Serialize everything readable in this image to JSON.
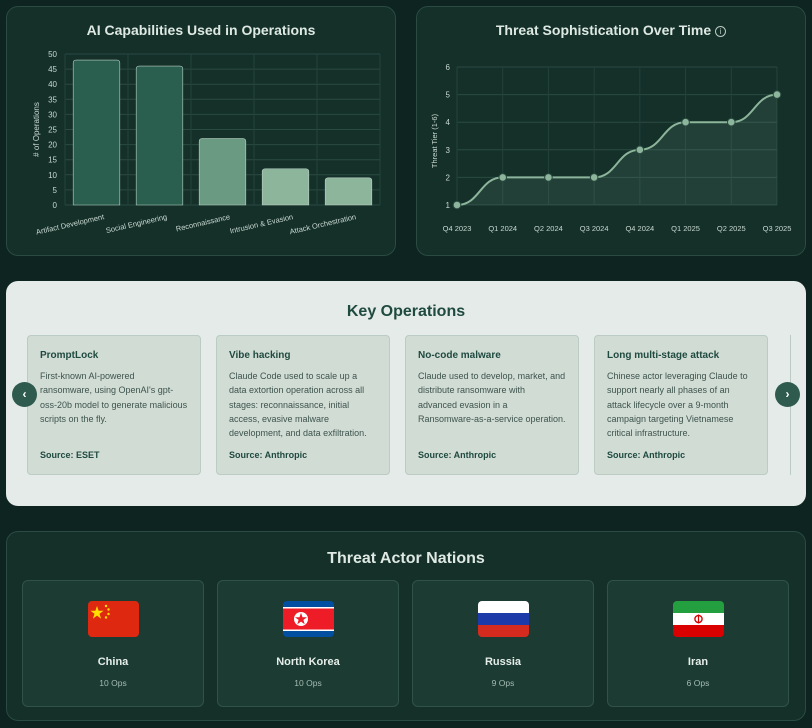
{
  "capabilities_panel": {
    "title": "AI Capabilities Used in Operations"
  },
  "threat_panel": {
    "title": "Threat Sophistication Over Time",
    "info_icon": "info-icon"
  },
  "chart_data": [
    {
      "type": "bar",
      "title": "AI Capabilities Used in Operations",
      "ylabel": "# of Operations",
      "xlabel": "",
      "categories": [
        "Artifact Development",
        "Social Engineering",
        "Reconnaissance",
        "Intrusion & Evasion",
        "Attack Orchestration"
      ],
      "values": [
        48,
        46,
        22,
        12,
        9
      ],
      "ylim": [
        0,
        50
      ],
      "yticks": [
        0,
        5,
        10,
        15,
        20,
        25,
        30,
        35,
        40,
        45,
        50
      ],
      "colors": [
        "#2a5e4f",
        "#2a5e4f",
        "#6a9a82",
        "#8cb59b",
        "#8cb59b"
      ],
      "grid": true
    },
    {
      "type": "line",
      "title": "Threat Sophistication Over Time",
      "ylabel": "Threat Tier (1-6)",
      "xlabel": "",
      "x": [
        "Q4 2023",
        "Q1 2024",
        "Q2 2024",
        "Q3 2024",
        "Q4 2024",
        "Q1 2025",
        "Q2 2025",
        "Q3 2025"
      ],
      "values": [
        1,
        2,
        2,
        2,
        3,
        4,
        4,
        5
      ],
      "ylim": [
        1,
        6
      ],
      "yticks": [
        1,
        2,
        3,
        4,
        5,
        6
      ],
      "line_color": "#8cb59b",
      "grid": true
    }
  ],
  "operations": {
    "title": "Key Operations",
    "prev_icon": "chevron-left-icon",
    "next_icon": "chevron-right-icon",
    "cards": [
      {
        "title": "PromptLock",
        "description": "First-known AI-powered ransomware, using OpenAI's gpt-oss-20b model to generate malicious scripts on the fly.",
        "source": "Source: ESET"
      },
      {
        "title": "Vibe hacking",
        "description": "Claude Code used to scale up a data extortion operation across all stages: reconnaissance, initial access, evasive malware development, and data exfiltration.",
        "source": "Source: Anthropic"
      },
      {
        "title": "No-code malware",
        "description": "Claude used to develop, market, and distribute ransomware with advanced evasion in a Ransomware-as-a-service operation.",
        "source": "Source: Anthropic"
      },
      {
        "title": "Long multi-stage attack",
        "description": "Chinese actor leveraging Claude to support nearly all phases of an attack lifecycle over a 9-month campaign targeting Vietnamese critical infrastructure.",
        "source": "Source: Anthropic"
      }
    ]
  },
  "nations": {
    "title": "Threat Actor Nations",
    "items": [
      {
        "name": "China",
        "ops": "10 Ops",
        "flag": "china-flag-icon"
      },
      {
        "name": "North Korea",
        "ops": "10 Ops",
        "flag": "north-korea-flag-icon"
      },
      {
        "name": "Russia",
        "ops": "9 Ops",
        "flag": "russia-flag-icon"
      },
      {
        "name": "Iran",
        "ops": "6 Ops",
        "flag": "iran-flag-icon"
      }
    ]
  }
}
